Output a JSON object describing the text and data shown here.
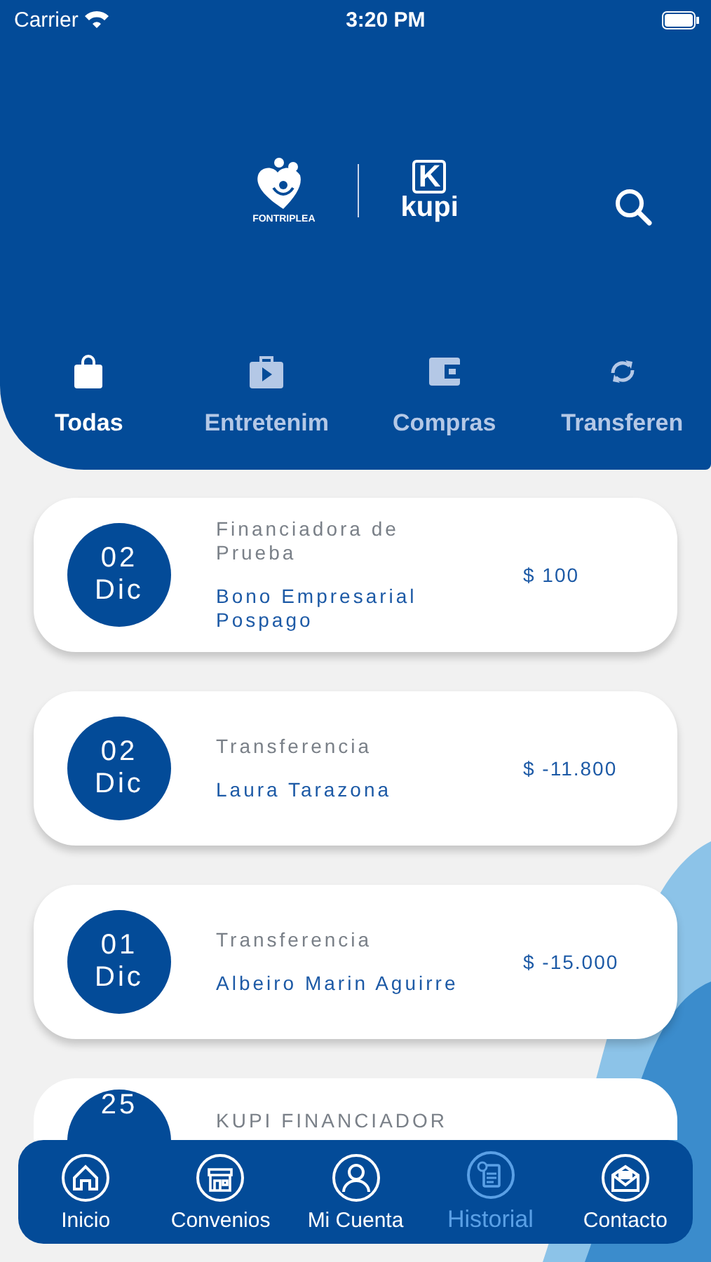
{
  "status_bar": {
    "carrier": "Carrier",
    "time": "3:20 PM"
  },
  "header": {
    "logos": [
      {
        "kind": "heart",
        "name": "FONTRIPLEA"
      },
      {
        "kind": "kupi",
        "mark": "K",
        "name": "kupi"
      }
    ]
  },
  "tabs": [
    {
      "label": "Todas",
      "selected": true
    },
    {
      "label": "Entretenim",
      "selected": false
    },
    {
      "label": "Compras",
      "selected": false
    },
    {
      "label": "Transferen",
      "selected": false
    }
  ],
  "transactions": [
    {
      "day": "02",
      "month": "Dic",
      "category": "Financiadora de Prueba",
      "name": "Bono Empresarial Pospago",
      "amount": "$ 100"
    },
    {
      "day": "02",
      "month": "Dic",
      "category": "Transferencia",
      "name": "Laura Tarazona",
      "amount": "$ -11.800"
    },
    {
      "day": "01",
      "month": "Dic",
      "category": "Transferencia",
      "name": "Albeiro Marin Aguirre",
      "amount": "$ -15.000"
    },
    {
      "day": "25",
      "category": "KUPI FINANCIADOR"
    }
  ],
  "bottom_nav": [
    {
      "label": "Inicio",
      "selected": false
    },
    {
      "label": "Convenios",
      "selected": false
    },
    {
      "label": "Mi Cuenta",
      "selected": false
    },
    {
      "label": "Historial",
      "selected": true
    },
    {
      "label": "Contacto",
      "selected": false
    }
  ]
}
